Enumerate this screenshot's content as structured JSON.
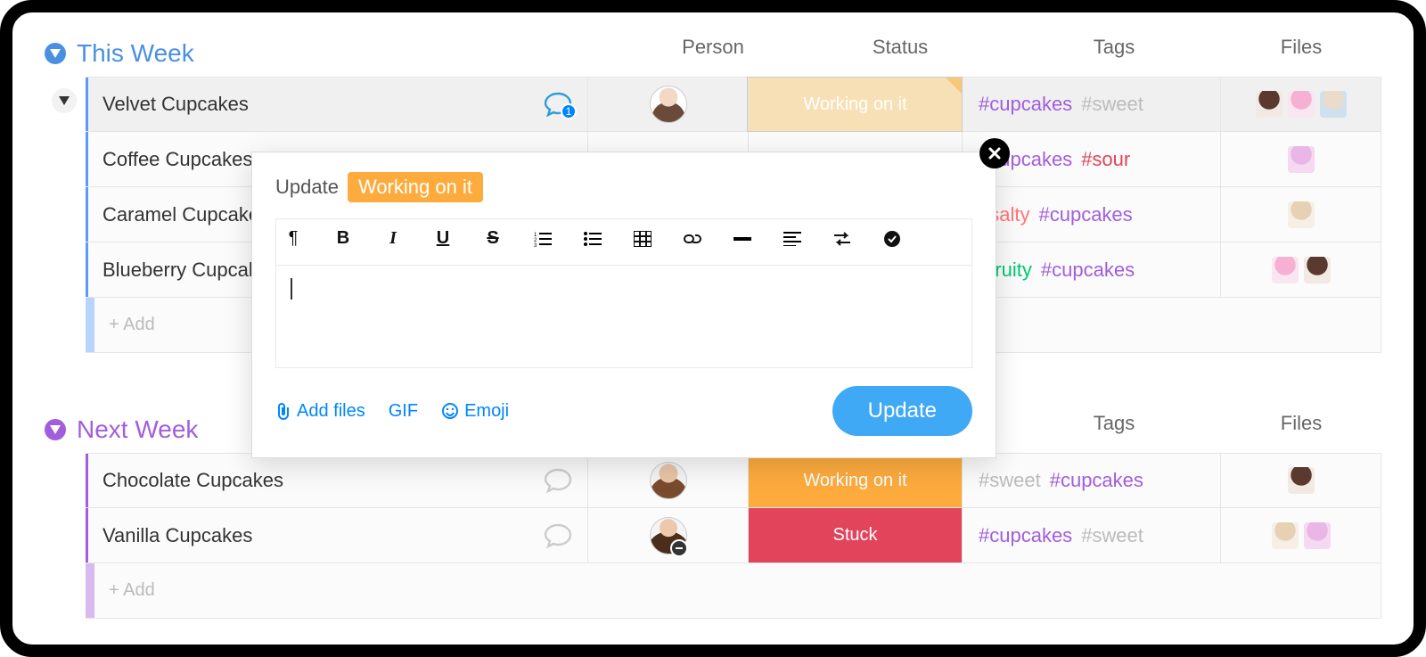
{
  "columns": {
    "person": "Person",
    "status": "Status",
    "tags": "Tags",
    "files": "Files"
  },
  "groups": {
    "thisWeek": {
      "title": "This Week",
      "addLabel": "+ Add",
      "rows": [
        {
          "name": "Velvet Cupcakes",
          "chatCount": "1",
          "status": "Working on it",
          "tags": [
            {
              "text": "#cupcakes",
              "cls": "cupcakes"
            },
            {
              "text": "#sweet",
              "cls": "sweet"
            }
          ],
          "files": [
            "t1",
            "t2",
            "t3"
          ]
        },
        {
          "name": "Coffee Cupcakes",
          "status": "",
          "tags": [
            {
              "text": "#cupcakes",
              "cls": "cupcakes"
            },
            {
              "text": "#sour",
              "cls": "sour"
            }
          ],
          "files": [
            "t4"
          ]
        },
        {
          "name": "Caramel Cupcakes",
          "status": "",
          "tags": [
            {
              "text": "#salty",
              "cls": "salty"
            },
            {
              "text": "#cupcakes",
              "cls": "cupcakes"
            }
          ],
          "files": [
            "t5"
          ]
        },
        {
          "name": "Blueberry Cupcakes",
          "status": "",
          "tags": [
            {
              "text": "#fruity",
              "cls": "fruity"
            },
            {
              "text": "#cupcakes",
              "cls": "cupcakes"
            }
          ],
          "files": [
            "t2",
            "t1"
          ]
        }
      ]
    },
    "nextWeek": {
      "title": "Next Week",
      "addLabel": "+ Add",
      "rows": [
        {
          "name": "Chocolate Cupcakes",
          "status": "Working on it",
          "tags": [
            {
              "text": "#sweet",
              "cls": "sweet"
            },
            {
              "text": "#cupcakes",
              "cls": "cupcakes"
            }
          ],
          "files": [
            "t1"
          ]
        },
        {
          "name": "Vanilla Cupcakes",
          "status": "Stuck",
          "tags": [
            {
              "text": "#cupcakes",
              "cls": "cupcakes"
            },
            {
              "text": "#sweet",
              "cls": "sweet"
            }
          ],
          "files": [
            "t5",
            "t4"
          ]
        }
      ]
    }
  },
  "popover": {
    "titlePrefix": "Update",
    "statusLabel": "Working on it",
    "addFiles": "Add files",
    "gif": "GIF",
    "emoji": "Emoji",
    "submit": "Update"
  }
}
